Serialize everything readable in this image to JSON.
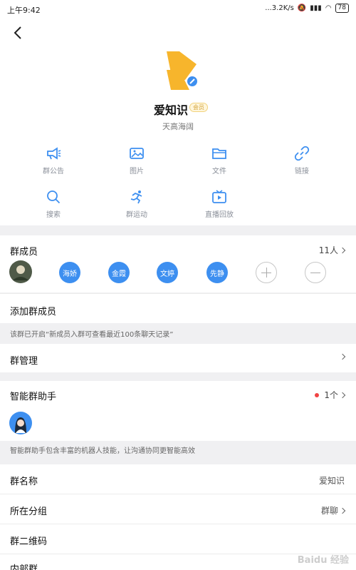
{
  "status": {
    "time": "上午9:42",
    "speed": "...3.2K/s",
    "battery": "78"
  },
  "group": {
    "name": "爱知识",
    "badge": "会员",
    "subtitle": "天高海阔"
  },
  "functions": [
    "群公告",
    "图片",
    "文件",
    "链接",
    "搜索",
    "群运动",
    "直播回放"
  ],
  "members": {
    "title": "群成员",
    "count": "11人",
    "names": [
      "海娇",
      "金霞",
      "文婷",
      "先静"
    ]
  },
  "add_member": "添加群成员",
  "history_note": "该群已开启“新成员入群可查看最近100条聊天记录”",
  "manage": "群管理",
  "assistant": {
    "title": "智能群助手",
    "count": "1个",
    "note": "智能群助手包含丰富的机器人技能，让沟通协同更智能高效"
  },
  "info_rows": [
    {
      "label": "群名称",
      "value": "爱知识"
    },
    {
      "label": "所在分组",
      "value": "群聊"
    },
    {
      "label": "群二维码",
      "value": ""
    },
    {
      "label": "内部群",
      "value": ""
    }
  ],
  "watermark": "Baidu 经验",
  "colors": {
    "accent": "#3d8ff0",
    "logo": "#f7b52c",
    "badge": "#d3a43c"
  }
}
